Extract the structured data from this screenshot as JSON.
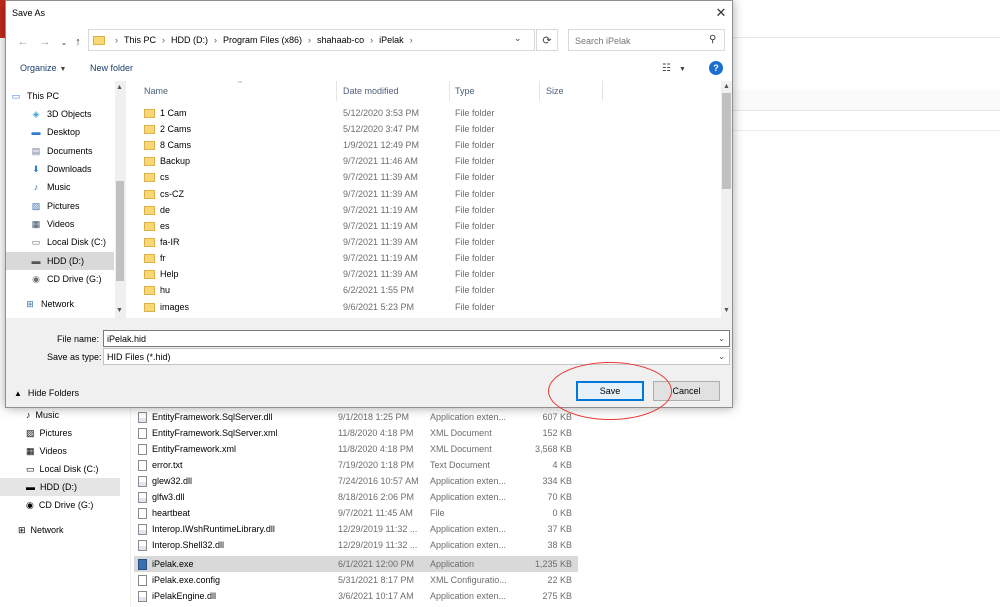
{
  "background": {
    "nav_items": [
      {
        "label": "Music",
        "icon": "music-icon"
      },
      {
        "label": "Pictures",
        "icon": "pictures-icon"
      },
      {
        "label": "Videos",
        "icon": "videos-icon"
      },
      {
        "label": "Local Disk (C:)",
        "icon": "drive-icon"
      },
      {
        "label": "HDD (D:)",
        "icon": "drive-icon",
        "selected": true
      },
      {
        "label": "CD Drive (G:)",
        "icon": "cd-drive-icon"
      },
      {
        "label": "Network",
        "icon": "network-icon"
      }
    ],
    "files": [
      {
        "name": "EntityFramework.SqlServer.dll",
        "date": "9/1/2018 1:25 PM",
        "type": "Application exten...",
        "size": "607 KB",
        "kind": "dll"
      },
      {
        "name": "EntityFramework.SqlServer.xml",
        "date": "11/8/2020 4:18 PM",
        "type": "XML Document",
        "size": "152 KB",
        "kind": "file"
      },
      {
        "name": "EntityFramework.xml",
        "date": "11/8/2020 4:18 PM",
        "type": "XML Document",
        "size": "3,568 KB",
        "kind": "file"
      },
      {
        "name": "error.txt",
        "date": "7/19/2020 1:18 PM",
        "type": "Text Document",
        "size": "4 KB",
        "kind": "file"
      },
      {
        "name": "glew32.dll",
        "date": "7/24/2016 10:57 AM",
        "type": "Application exten...",
        "size": "334 KB",
        "kind": "dll"
      },
      {
        "name": "glfw3.dll",
        "date": "8/18/2016 2:06 PM",
        "type": "Application exten...",
        "size": "70 KB",
        "kind": "dll"
      },
      {
        "name": "heartbeat",
        "date": "9/7/2021 11:45 AM",
        "type": "File",
        "size": "0 KB",
        "kind": "file"
      },
      {
        "name": "Interop.IWshRuntimeLibrary.dll",
        "date": "12/29/2019 11:32 ...",
        "type": "Application exten...",
        "size": "37 KB",
        "kind": "dll"
      },
      {
        "name": "Interop.Shell32.dll",
        "date": "12/29/2019 11:32 ...",
        "type": "Application exten...",
        "size": "38 KB",
        "kind": "dll"
      },
      {
        "name": "iPelak.exe",
        "date": "6/1/2021 12:00 PM",
        "type": "Application",
        "size": "1,235 KB",
        "kind": "exe",
        "selected": true
      },
      {
        "name": "iPelak.exe.config",
        "date": "5/31/2021 8:17 PM",
        "type": "XML Configuratio...",
        "size": "22 KB",
        "kind": "config"
      },
      {
        "name": "iPelakEngine.dll",
        "date": "3/6/2021 10:17 AM",
        "type": "Application exten...",
        "size": "275 KB",
        "kind": "dll"
      }
    ]
  },
  "dialog": {
    "title": "Save As",
    "close_glyph": "✕",
    "nav": {
      "back": "←",
      "forward": "→",
      "recent": "⌄",
      "up": "↑"
    },
    "address": {
      "crumbs": [
        "This PC",
        "HDD (D:)",
        "Program Files (x86)",
        "shahaab-co",
        "iPelak"
      ],
      "separator": "›"
    },
    "search_placeholder": "Search iPelak",
    "toolbar": {
      "organize": "Organize",
      "new_folder": "New folder"
    },
    "nav_pane": [
      {
        "label": "This PC",
        "icon": "pc-icon",
        "glyph": "▭"
      },
      {
        "label": "3D Objects",
        "icon": "3d-objects-icon",
        "glyph": "◈"
      },
      {
        "label": "Desktop",
        "icon": "desktop-icon",
        "glyph": "▬"
      },
      {
        "label": "Documents",
        "icon": "documents-icon",
        "glyph": "▤"
      },
      {
        "label": "Downloads",
        "icon": "downloads-icon",
        "glyph": "⬇"
      },
      {
        "label": "Music",
        "icon": "music-icon",
        "glyph": "♪"
      },
      {
        "label": "Pictures",
        "icon": "pictures-icon",
        "glyph": "▨"
      },
      {
        "label": "Videos",
        "icon": "videos-icon",
        "glyph": "▦"
      },
      {
        "label": "Local Disk (C:)",
        "icon": "drive-icon",
        "glyph": "▭"
      },
      {
        "label": "HDD (D:)",
        "icon": "drive-icon",
        "glyph": "▬",
        "selected": true
      },
      {
        "label": "CD Drive (G:)",
        "icon": "cd-drive-icon",
        "glyph": "◉"
      },
      {
        "label": "Network",
        "icon": "network-icon",
        "glyph": "⊞"
      }
    ],
    "columns": {
      "name": "Name",
      "date": "Date modified",
      "type": "Type",
      "size": "Size"
    },
    "folders": [
      {
        "name": "1 Cam",
        "date": "5/12/2020 3:53 PM",
        "type": "File folder"
      },
      {
        "name": "2 Cams",
        "date": "5/12/2020 3:47 PM",
        "type": "File folder"
      },
      {
        "name": "8 Cams",
        "date": "1/9/2021 12:49 PM",
        "type": "File folder"
      },
      {
        "name": "Backup",
        "date": "9/7/2021 11:46 AM",
        "type": "File folder"
      },
      {
        "name": "cs",
        "date": "9/7/2021 11:39 AM",
        "type": "File folder"
      },
      {
        "name": "cs-CZ",
        "date": "9/7/2021 11:39 AM",
        "type": "File folder"
      },
      {
        "name": "de",
        "date": "9/7/2021 11:19 AM",
        "type": "File folder"
      },
      {
        "name": "es",
        "date": "9/7/2021 11:19 AM",
        "type": "File folder"
      },
      {
        "name": "fa-IR",
        "date": "9/7/2021 11:39 AM",
        "type": "File folder"
      },
      {
        "name": "fr",
        "date": "9/7/2021 11:19 AM",
        "type": "File folder"
      },
      {
        "name": "Help",
        "date": "9/7/2021 11:39 AM",
        "type": "File folder"
      },
      {
        "name": "hu",
        "date": "6/2/2021 1:55 PM",
        "type": "File folder"
      },
      {
        "name": "images",
        "date": "9/6/2021 5:23 PM",
        "type": "File folder"
      }
    ],
    "form": {
      "file_name_label": "File name:",
      "file_name_value": "iPelak.hid",
      "save_type_label": "Save as type:",
      "save_type_value": "HID Files (*.hid)"
    },
    "hide_folders": "Hide Folders",
    "save": "Save",
    "cancel": "Cancel"
  },
  "colors": {
    "accent": "#0078d7",
    "annotation_ring": "#e53935",
    "folder": "#f8d775"
  }
}
